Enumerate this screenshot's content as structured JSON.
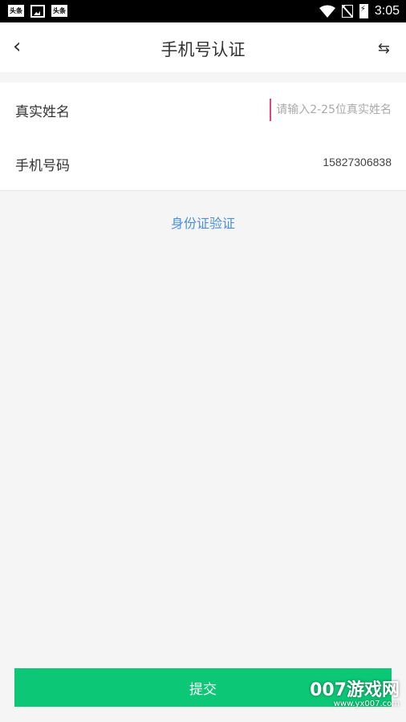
{
  "status_bar": {
    "left_icons": [
      "toutiao-icon",
      "image-icon",
      "toutiao-icon"
    ],
    "left_icon_label": "头条",
    "time": "3:05"
  },
  "header": {
    "back_glyph": "‹",
    "title": "手机号认证",
    "switch_glyph": "⇆"
  },
  "form": {
    "real_name_label": "真实姓名",
    "real_name_placeholder": "请输入2-25位真实姓名",
    "real_name_value": "",
    "phone_label": "手机号码",
    "phone_value": "15827306838"
  },
  "id_verify_link": "身份证验证",
  "submit_label": "提交",
  "watermark": {
    "main": "007游戏网",
    "url": "www.yx007.com"
  },
  "colors": {
    "accent_green": "#0cc776",
    "link_blue": "#4a90d9",
    "cursor_pink": "#e8437a"
  }
}
